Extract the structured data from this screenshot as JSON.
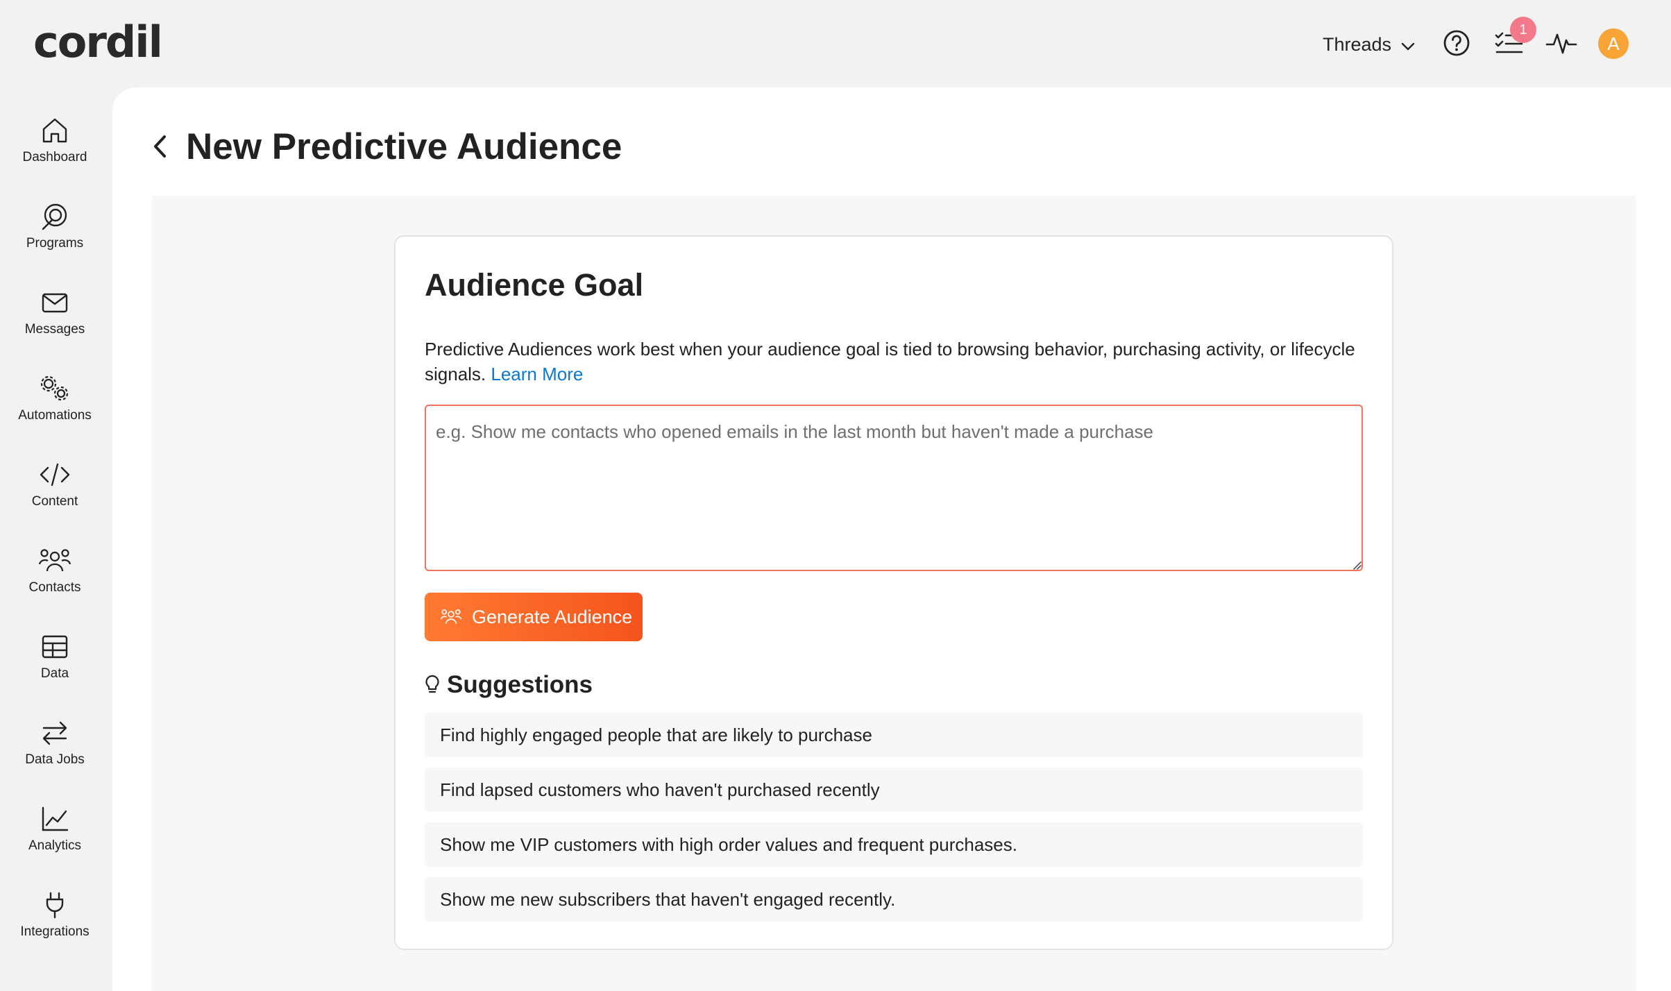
{
  "app": {
    "logo_text": "cordi",
    "logo_tail": "l"
  },
  "header": {
    "threads_label": "Threads",
    "tasks_badge": "1",
    "avatar_initial": "A"
  },
  "sidebar": {
    "items": [
      {
        "label": "Dashboard",
        "icon": "home-icon"
      },
      {
        "label": "Programs",
        "icon": "programs-icon"
      },
      {
        "label": "Messages",
        "icon": "envelope-icon"
      },
      {
        "label": "Automations",
        "icon": "gears-icon"
      },
      {
        "label": "Content",
        "icon": "code-icon"
      },
      {
        "label": "Contacts",
        "icon": "people-icon"
      },
      {
        "label": "Data",
        "icon": "table-icon"
      },
      {
        "label": "Data Jobs",
        "icon": "arrows-exchange-icon"
      },
      {
        "label": "Analytics",
        "icon": "line-chart-icon"
      },
      {
        "label": "Integrations",
        "icon": "plug-icon"
      }
    ]
  },
  "page": {
    "title": "New Predictive Audience"
  },
  "card": {
    "title": "Audience Goal",
    "description": "Predictive Audiences work best when your audience goal is tied to browsing behavior, purchasing activity, or lifecycle signals.",
    "learn_more": "Learn More",
    "input_placeholder": "e.g. Show me contacts who opened emails in the last month but haven't made a purchase",
    "input_value": "",
    "generate_label": "Generate Audience",
    "suggestions_title": "Suggestions",
    "suggestions": [
      "Find highly engaged people that are likely to purchase",
      "Find lapsed customers who haven't purchased recently",
      "Show me VIP customers with high order values and frequent purchases.",
      "Show me new subscribers that haven't engaged recently."
    ]
  },
  "colors": {
    "accent": "#f5541c",
    "accent_light": "#ff7a33",
    "link": "#0a78d1",
    "badge": "#f2788a",
    "avatar": "#f9a436",
    "input_border": "#f0735a"
  }
}
